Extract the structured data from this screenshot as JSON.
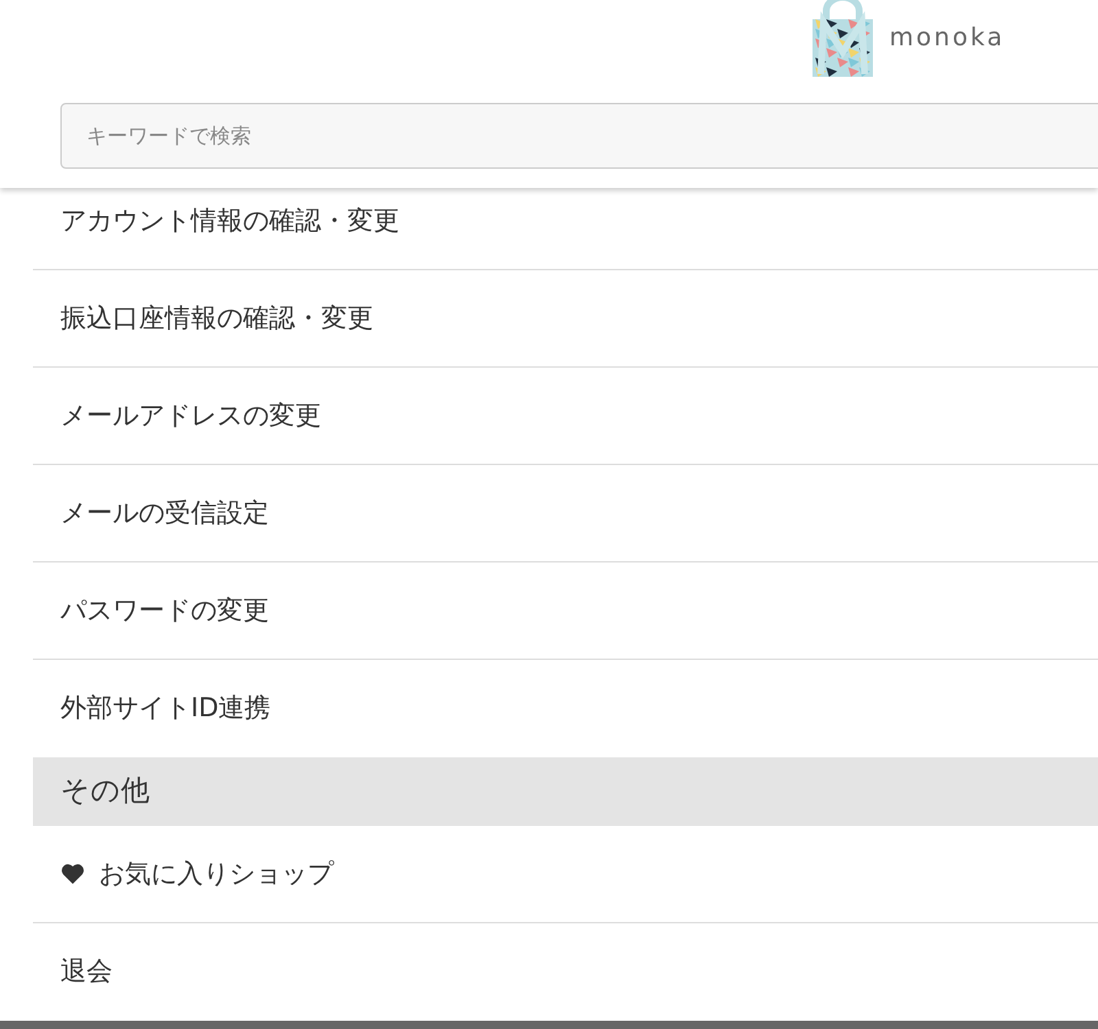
{
  "header": {
    "logo_text": "monoka"
  },
  "search": {
    "placeholder": "キーワードで検索"
  },
  "menu": [
    {
      "kind": "link",
      "label": "アカウント情報の確認・変更"
    },
    {
      "kind": "link",
      "label": "振込口座情報の確認・変更"
    },
    {
      "kind": "link",
      "label": "メールアドレスの変更"
    },
    {
      "kind": "link",
      "label": "メールの受信設定"
    },
    {
      "kind": "link",
      "label": "パスワードの変更"
    },
    {
      "kind": "link",
      "label": "外部サイトID連携"
    },
    {
      "kind": "section",
      "label": "その他"
    },
    {
      "kind": "favorite",
      "label": "お気に入りショップ"
    },
    {
      "kind": "link",
      "label": "退会"
    }
  ]
}
